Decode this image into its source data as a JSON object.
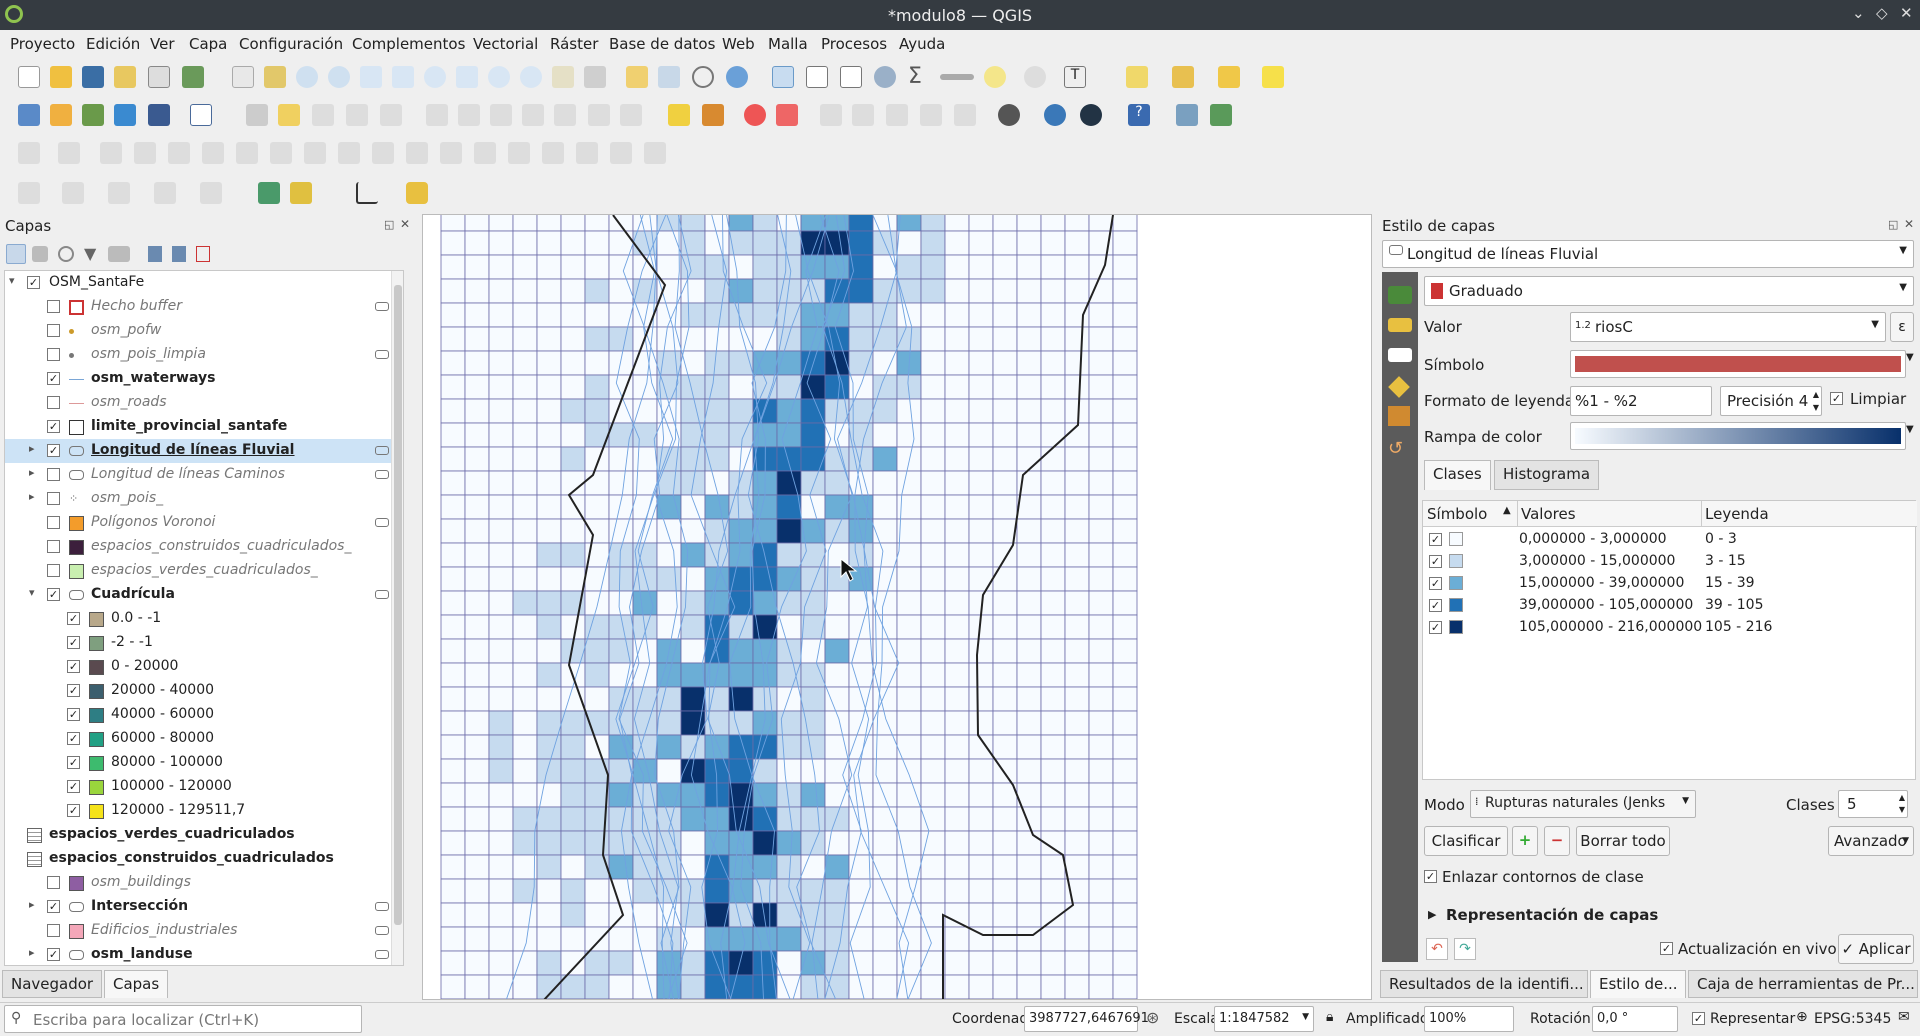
{
  "window": {
    "title": "*modulo8 — QGIS"
  },
  "menu": [
    "Proyecto",
    "Edición",
    "Ver",
    "Capa",
    "Configuración",
    "Complementos",
    "Vectorial",
    "Ráster",
    "Base de datos",
    "Web",
    "Malla",
    "Procesos",
    "Ayuda"
  ],
  "layers_panel": {
    "title": "Capas",
    "items": [
      {
        "label": "OSM_SantaFe",
        "checked": true,
        "style": "group",
        "symbol": "none",
        "expand": "▾",
        "indent": 0
      },
      {
        "label": "Hecho buffer",
        "checked": false,
        "style": "italic",
        "symbol": "red-outline",
        "indent": 1
      },
      {
        "label": "osm_pofw",
        "checked": false,
        "style": "italic",
        "symbol": "dot-yellow",
        "indent": 1
      },
      {
        "label": "osm_pois_limpia",
        "checked": false,
        "style": "italic",
        "symbol": "dot-gray",
        "indent": 1
      },
      {
        "label": "osm_waterways",
        "checked": true,
        "style": "bold",
        "symbol": "line-blue",
        "indent": 1
      },
      {
        "label": "osm_roads",
        "checked": false,
        "style": "italic",
        "symbol": "line-pink",
        "indent": 1
      },
      {
        "label": "limite_provincial_santafe",
        "checked": true,
        "style": "bold",
        "symbol": "box-outline",
        "indent": 1
      },
      {
        "label": "Longitud de líneas Fluvial",
        "checked": true,
        "style": "bold-underline",
        "symbol": "multi",
        "expand": "▸",
        "indent": 1,
        "selected": true
      },
      {
        "label": "Longitud de líneas Caminos",
        "checked": false,
        "style": "italic",
        "symbol": "multi",
        "expand": "▸",
        "indent": 1
      },
      {
        "label": "osm_pois_",
        "checked": false,
        "style": "italic",
        "symbol": "dots",
        "expand": "▸",
        "indent": 1
      },
      {
        "label": "Polígonos Voronoi",
        "checked": false,
        "style": "italic",
        "symbol": "orange",
        "indent": 1
      },
      {
        "label": "espacios_construidos_cuadriculados_",
        "checked": false,
        "style": "italic",
        "symbol": "dark-purple",
        "indent": 1
      },
      {
        "label": "espacios_verdes_cuadriculados_",
        "checked": false,
        "style": "italic",
        "symbol": "light-green",
        "indent": 1
      },
      {
        "label": "Cuadrícula",
        "checked": true,
        "style": "bold",
        "symbol": "multi",
        "expand": "▾",
        "indent": 1
      },
      {
        "label": "0.0 - -1",
        "checked": true,
        "style": "normal",
        "symbol": "#b8a88a",
        "indent": 2
      },
      {
        "label": "-2 - -1",
        "checked": true,
        "style": "normal",
        "symbol": "#7f9f7f",
        "indent": 2
      },
      {
        "label": "0 - 20000",
        "checked": true,
        "style": "normal",
        "symbol": "#5a4a4f",
        "indent": 2
      },
      {
        "label": "20000 - 40000",
        "checked": true,
        "style": "normal",
        "symbol": "#3c5f6e",
        "indent": 2
      },
      {
        "label": "40000 - 60000",
        "checked": true,
        "style": "normal",
        "symbol": "#2e7e84",
        "indent": 2
      },
      {
        "label": "60000 - 80000",
        "checked": true,
        "style": "normal",
        "symbol": "#21a084",
        "indent": 2
      },
      {
        "label": "80000 - 100000",
        "checked": true,
        "style": "normal",
        "symbol": "#3dbb6e",
        "indent": 2
      },
      {
        "label": "100000 - 120000",
        "checked": true,
        "style": "normal",
        "symbol": "#9ad53c",
        "indent": 2
      },
      {
        "label": "120000 - 129511,7",
        "checked": true,
        "style": "normal",
        "symbol": "#f5e31a",
        "indent": 2
      },
      {
        "label": "espacios_verdes_cuadriculados",
        "checked": null,
        "style": "bold",
        "symbol": "table",
        "indent": 0
      },
      {
        "label": "espacios_construidos_cuadriculados",
        "checked": null,
        "style": "bold",
        "symbol": "table",
        "indent": 0
      },
      {
        "label": "osm_buildings",
        "checked": false,
        "style": "italic",
        "symbol": "purple",
        "indent": 1
      },
      {
        "label": "Intersección",
        "checked": true,
        "style": "bold",
        "symbol": "multi",
        "expand": "▸",
        "indent": 1
      },
      {
        "label": "Edificios_industriales",
        "checked": false,
        "style": "italic",
        "symbol": "pink",
        "indent": 1
      },
      {
        "label": "osm_landuse",
        "checked": true,
        "style": "bold",
        "symbol": "multi",
        "expand": "▸",
        "indent": 1
      }
    ]
  },
  "bottom_tabs_left": {
    "navigator": "Navegador",
    "layers": "Capas"
  },
  "search": {
    "placeholder": "Escriba para localizar (Ctrl+K)"
  },
  "style_panel": {
    "title": "Estilo de capas",
    "layer": "Longitud de líneas Fluvial",
    "renderer": "Graduado",
    "valor_label": "Valor",
    "valor": "riosC",
    "valor_prefix": "1.2",
    "simbolo_label": "Símbolo",
    "simbolo_color": "#c0504d",
    "formato_label": "Formato de leyenda",
    "formato": "%1 - %2",
    "precision": "Precisión 4",
    "limpiar": "Limpiar",
    "rampa_label": "Rampa de color",
    "tabs": {
      "clases": "Clases",
      "histograma": "Histograma"
    },
    "table_headers": {
      "simbolo": "Símbolo",
      "valores": "Valores",
      "leyenda": "Leyenda"
    },
    "classes": [
      {
        "color": "#f7fbff",
        "valores": "0,000000 - 3,000000",
        "leyenda": "0 - 3"
      },
      {
        "color": "#c6dbef",
        "valores": "3,000000 - 15,000000",
        "leyenda": "3 - 15"
      },
      {
        "color": "#6baed6",
        "valores": "15,000000 - 39,000000",
        "leyenda": "15 - 39"
      },
      {
        "color": "#2171b5",
        "valores": "39,000000 - 105,000000",
        "leyenda": "39 - 105"
      },
      {
        "color": "#08306b",
        "valores": "105,000000 - 216,000000",
        "leyenda": "105 - 216"
      }
    ],
    "modo_label": "Modo",
    "modo": "Rupturas naturales (Jenks",
    "clases_label": "Clases",
    "clases_count": "5",
    "clasificar": "Clasificar",
    "borrar": "Borrar todo",
    "avanzado": "Avanzado",
    "enlazar": "Enlazar contornos de clase",
    "representacion": "Representación de capas",
    "actualizacion": "Actualización en vivo",
    "aplicar": "Aplicar"
  },
  "bottom_tabs_right": [
    "Resultados de la identifi...",
    "Estilo de...",
    "Caja de herramientas de Pr..."
  ],
  "status": {
    "coord_label": "Coordenada",
    "coord": "3987727,6467691",
    "escala_label": "Escala",
    "escala": "1:1847582",
    "amplificador_label": "Amplificador",
    "amplificador": "100%",
    "rotacion_label": "Rotación",
    "rotacion": "0,0 °",
    "representar": "Representar",
    "epsg": "EPSG:5345"
  },
  "colors": {
    "accent": "#3c78d8",
    "ramp_start": "#f7fbff",
    "ramp_end": "#08306b"
  }
}
